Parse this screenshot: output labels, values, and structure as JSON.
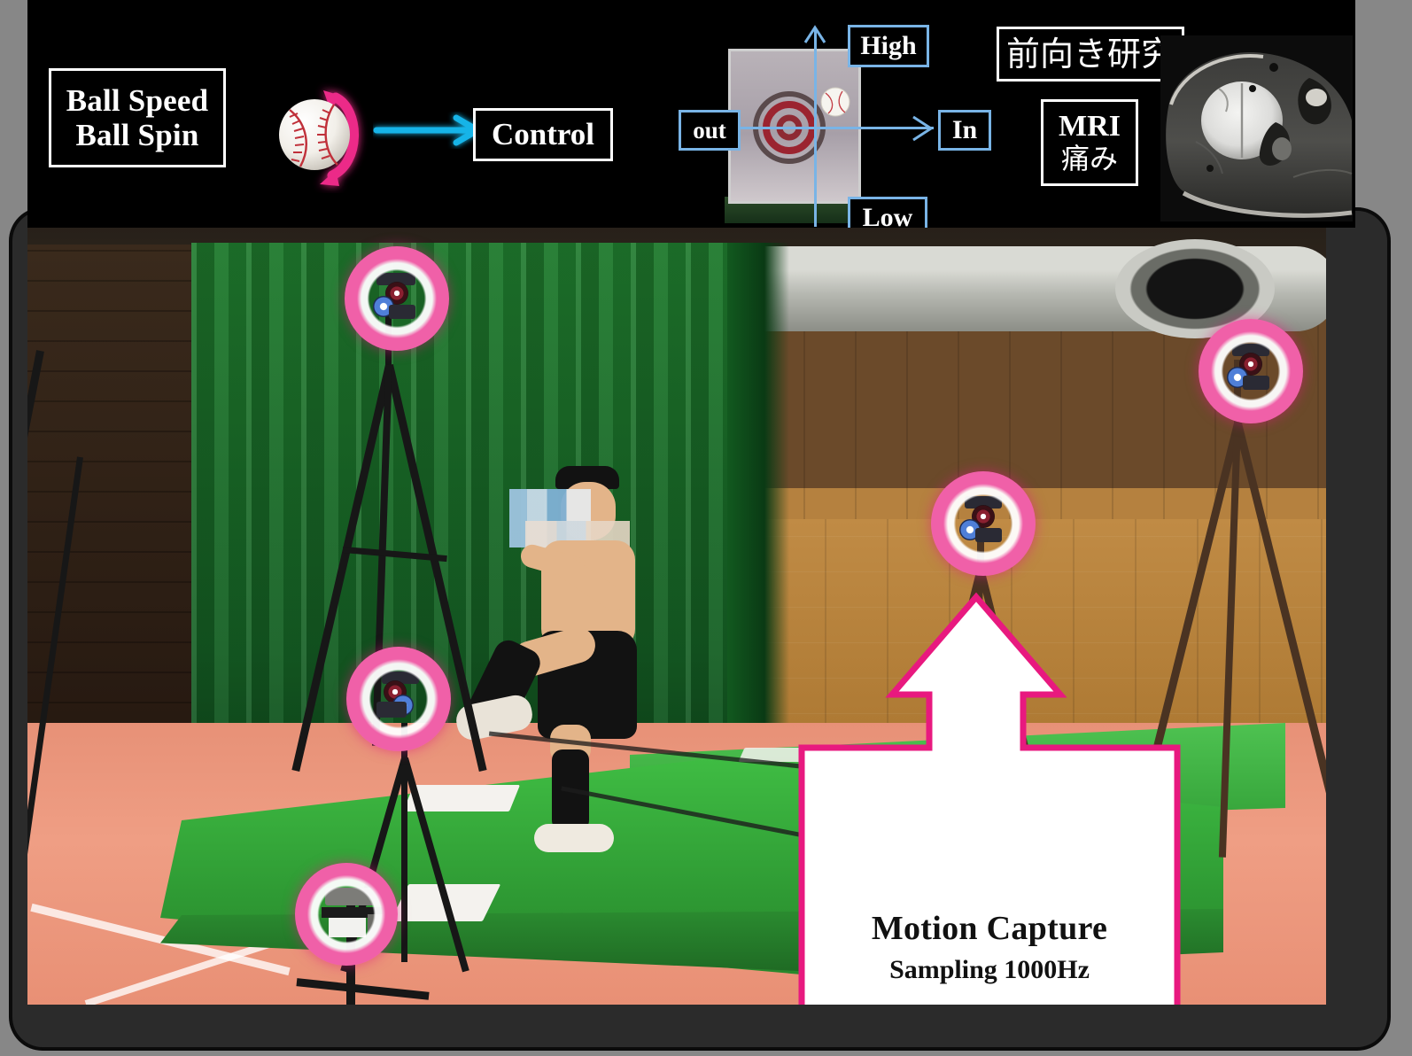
{
  "page": {
    "kind": "presentation-slide",
    "background_color": "#878787"
  },
  "banner": {
    "background_color": "#000000",
    "ball_metrics_box": {
      "line1": "Ball Speed",
      "line2": "Ball Spin",
      "border_color": "#ffffff"
    },
    "spin_ball": {
      "icon": "baseball-with-spin-arrow",
      "spin_arrow_color": "#e8197f"
    },
    "flow_arrow": {
      "icon": "right-arrow-icon",
      "color": "#18b4e8"
    },
    "control_box": {
      "label": "Control",
      "border_color": "#ffffff"
    },
    "target_diagram": {
      "axis_color": "#79b4e6",
      "labels": {
        "top": "High",
        "bottom": "Low",
        "left": "out",
        "right": "In"
      },
      "target_icon": "concentric-target-icon",
      "ball_icon": "baseball-icon"
    },
    "mri_panel": {
      "study_label": "前向き研究",
      "mri_label": "MRI",
      "pain_label": "痛み",
      "image_caption": "shoulder-mri-scan"
    }
  },
  "photo": {
    "scene": "indoor-baseball-pitching-lab",
    "highlight_ring_color": "#e0187f",
    "camera_highlights": [
      {
        "name": "mocap-camera-top-left",
        "device": "motion-capture-camera"
      },
      {
        "name": "mocap-camera-top-right",
        "device": "motion-capture-camera"
      },
      {
        "name": "mocap-camera-center-right",
        "device": "motion-capture-camera"
      },
      {
        "name": "mocap-camera-mid-left",
        "device": "motion-capture-camera"
      },
      {
        "name": "high-speed-camera-bottom-left",
        "device": "high-speed-camera"
      }
    ],
    "callout": {
      "title": "Motion Capture",
      "subtitle": "Sampling 1000Hz",
      "border_color": "#e8197f",
      "background_color": "#ffffff",
      "arrow_icon": "up-arrow-icon"
    }
  }
}
